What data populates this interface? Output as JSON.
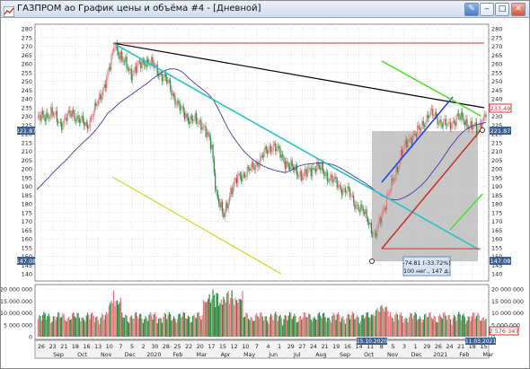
{
  "window": {
    "title": "ГАЗПРОМ ao График цены и объёма #4 - [Дневной]",
    "icons": [
      "chart-app-icon",
      "pin-icon",
      "minimize-icon",
      "maximize-icon",
      "close-icon"
    ]
  },
  "price_axis": {
    "ticks": [
      "280",
      "275",
      "270",
      "265",
      "260",
      "255",
      "250",
      "245",
      "240",
      "235",
      "230",
      "225",
      "220",
      "215",
      "210",
      "205",
      "200",
      "195",
      "190",
      "185",
      "180",
      "175",
      "170",
      "165",
      "160",
      "155",
      "150",
      "145",
      "140"
    ],
    "left_marker": "221.87",
    "left_bottom_marker": "147.08",
    "right_markers": {
      "current": "233.49",
      "cursor": "221.87",
      "bottom": "147.08"
    }
  },
  "volume_axis": {
    "ticks": [
      "20 000 000",
      "15 000 000",
      "10 000 000",
      "5 000 000",
      "0"
    ],
    "right_marker": "2 576 347"
  },
  "selection_box": {
    "line1": "-74.81 (-33.72%)",
    "line2": "100 нег., 147 д."
  },
  "time_axis": {
    "day_labels": [
      "26",
      "23",
      "21",
      "18",
      "16",
      "13",
      "10",
      "7",
      "5",
      "2",
      "30",
      "28",
      "25",
      "22",
      "20",
      "17",
      "15",
      "12",
      "10",
      "7",
      "4",
      "1",
      "29",
      "27",
      "24",
      "21",
      "19",
      "16",
      "14",
      "11",
      "8",
      "5",
      "3",
      "1",
      "29",
      "26",
      "24",
      "21",
      "18",
      "15"
    ],
    "month_labels": [
      "Sep",
      "Oct",
      "Nov",
      "Dec",
      "2020",
      "Feb",
      "Mar",
      "Apr",
      "May",
      "Jun",
      "Jul",
      "Aug",
      "Sep",
      "Oct",
      "Nov",
      "Dec",
      "2021",
      "Feb",
      "Mar"
    ],
    "date_markers": {
      "start": "15.10.2020",
      "end": "11.03.2021"
    }
  },
  "colors": {
    "up_candle": "#e8787e",
    "down_candle": "#2d8a3e",
    "ma_line": "#3c3caa",
    "black_trend": "#000000",
    "cyan_trend": "#2bc0c8",
    "red_levels": "#cc3333",
    "yellow_line": "#d6d63c",
    "blue_channel": "#2244ee",
    "green_lines": "#44dd22",
    "selection_fill": "#bdbdbd"
  }
}
